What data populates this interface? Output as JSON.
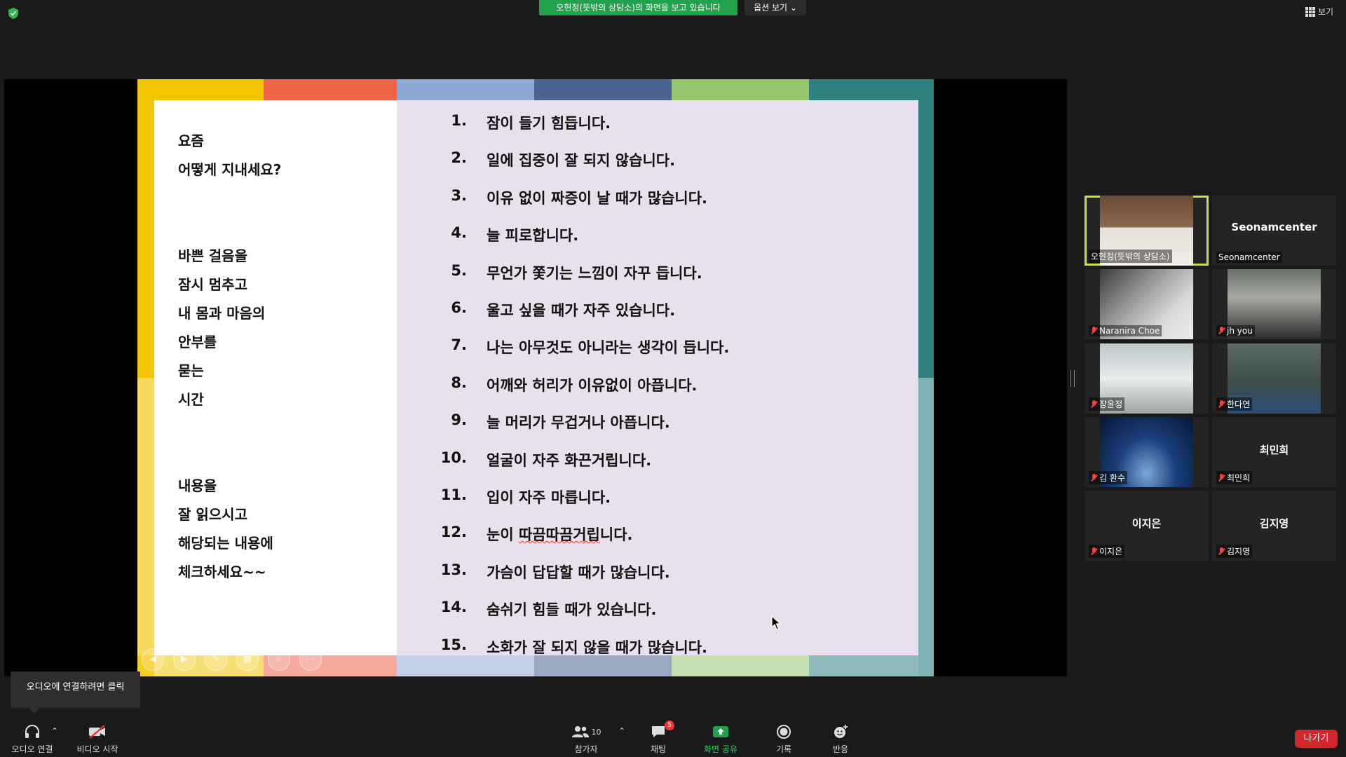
{
  "top_bar": {
    "share_banner": "오현정(뜻밖의 상담소)의 화면을 보고 있습니다",
    "options_label": "옵션 보기",
    "view_label": "보기"
  },
  "slide": {
    "left_lines": [
      "요즘",
      "어떻게 지내세요?",
      "바쁜 걸음을",
      "잠시 멈추고",
      "내 몸과 마음의",
      "안부를",
      "묻는",
      "시간",
      "내용을",
      "잘 읽으시고",
      "해당되는 내용에",
      "체크하세요~~"
    ],
    "items": [
      {
        "num": "1.",
        "text": "잠이 들기 힘듭니다."
      },
      {
        "num": "2.",
        "text": "일에 집중이 잘 되지 않습니다."
      },
      {
        "num": "3.",
        "text": "이유 없이 짜증이 날 때가 많습니다."
      },
      {
        "num": "4.",
        "text": "늘 피로합니다."
      },
      {
        "num": "5.",
        "text": "무언가 쫓기는 느낌이 자꾸 듭니다."
      },
      {
        "num": "6.",
        "text": "울고 싶을 때가 자주 있습니다."
      },
      {
        "num": "7.",
        "text": "나는 아무것도 아니라는 생각이 듭니다."
      },
      {
        "num": "8.",
        "text": "어깨와 허리가 이유없이 아픕니다."
      },
      {
        "num": "9.",
        "text": "늘 머리가 무겁거나 아픕니다."
      },
      {
        "num": "10.",
        "text": "얼굴이 자주 화끈거립니다."
      },
      {
        "num": "11.",
        "text": "입이 자주 마릅니다."
      },
      {
        "num": "12.",
        "text": "눈이 따끔따끔거립니다."
      },
      {
        "num": "13.",
        "text": "가슴이 답답할 때가 많습니다."
      },
      {
        "num": "14.",
        "text": "숨쉬기 힘들 때가 있습니다."
      },
      {
        "num": "15.",
        "text": "소화가 잘 되지 않을 때가 많습니다."
      }
    ],
    "strip_colors": [
      "#f2c500",
      "#ee6449",
      "#8fa8d3",
      "#4b6290",
      "#96c56e",
      "#2f7f7f"
    ]
  },
  "participants": [
    {
      "name": "오현정(뜻밖의 상담소)",
      "active": true,
      "video": true
    },
    {
      "name": "Seonamcenter",
      "center": "Seonamcenter",
      "video": false,
      "muted": false
    },
    {
      "name": "Naranira Choe",
      "video": true,
      "muted": true
    },
    {
      "name": "jh you",
      "video": true,
      "muted": true
    },
    {
      "name": "장윤정",
      "video": true,
      "muted": true
    },
    {
      "name": "한다연",
      "video": true,
      "muted": true
    },
    {
      "name": "김 환수",
      "video": true,
      "muted": true
    },
    {
      "name": "최민희",
      "center": "최민희",
      "video": false,
      "muted": true
    },
    {
      "name": "이지은",
      "center": "이지은",
      "video": false,
      "muted": true
    },
    {
      "name": "김지영",
      "center": "김지영",
      "video": false,
      "muted": true
    }
  ],
  "toolbar": {
    "tooltip": "오디오에 연결하려면 클릭",
    "audio_label": "오디오 연결",
    "video_label": "비디오 시작",
    "participants_label": "참가자",
    "participants_count": "10",
    "chat_label": "채팅",
    "chat_badge": "5",
    "share_label": "화면 공유",
    "record_label": "기록",
    "reactions_label": "반응",
    "leave_label": "나가기"
  },
  "colors": {
    "share_green": "#23a24d",
    "active_border": "#c8e04a",
    "leave_red": "#d2262d"
  }
}
